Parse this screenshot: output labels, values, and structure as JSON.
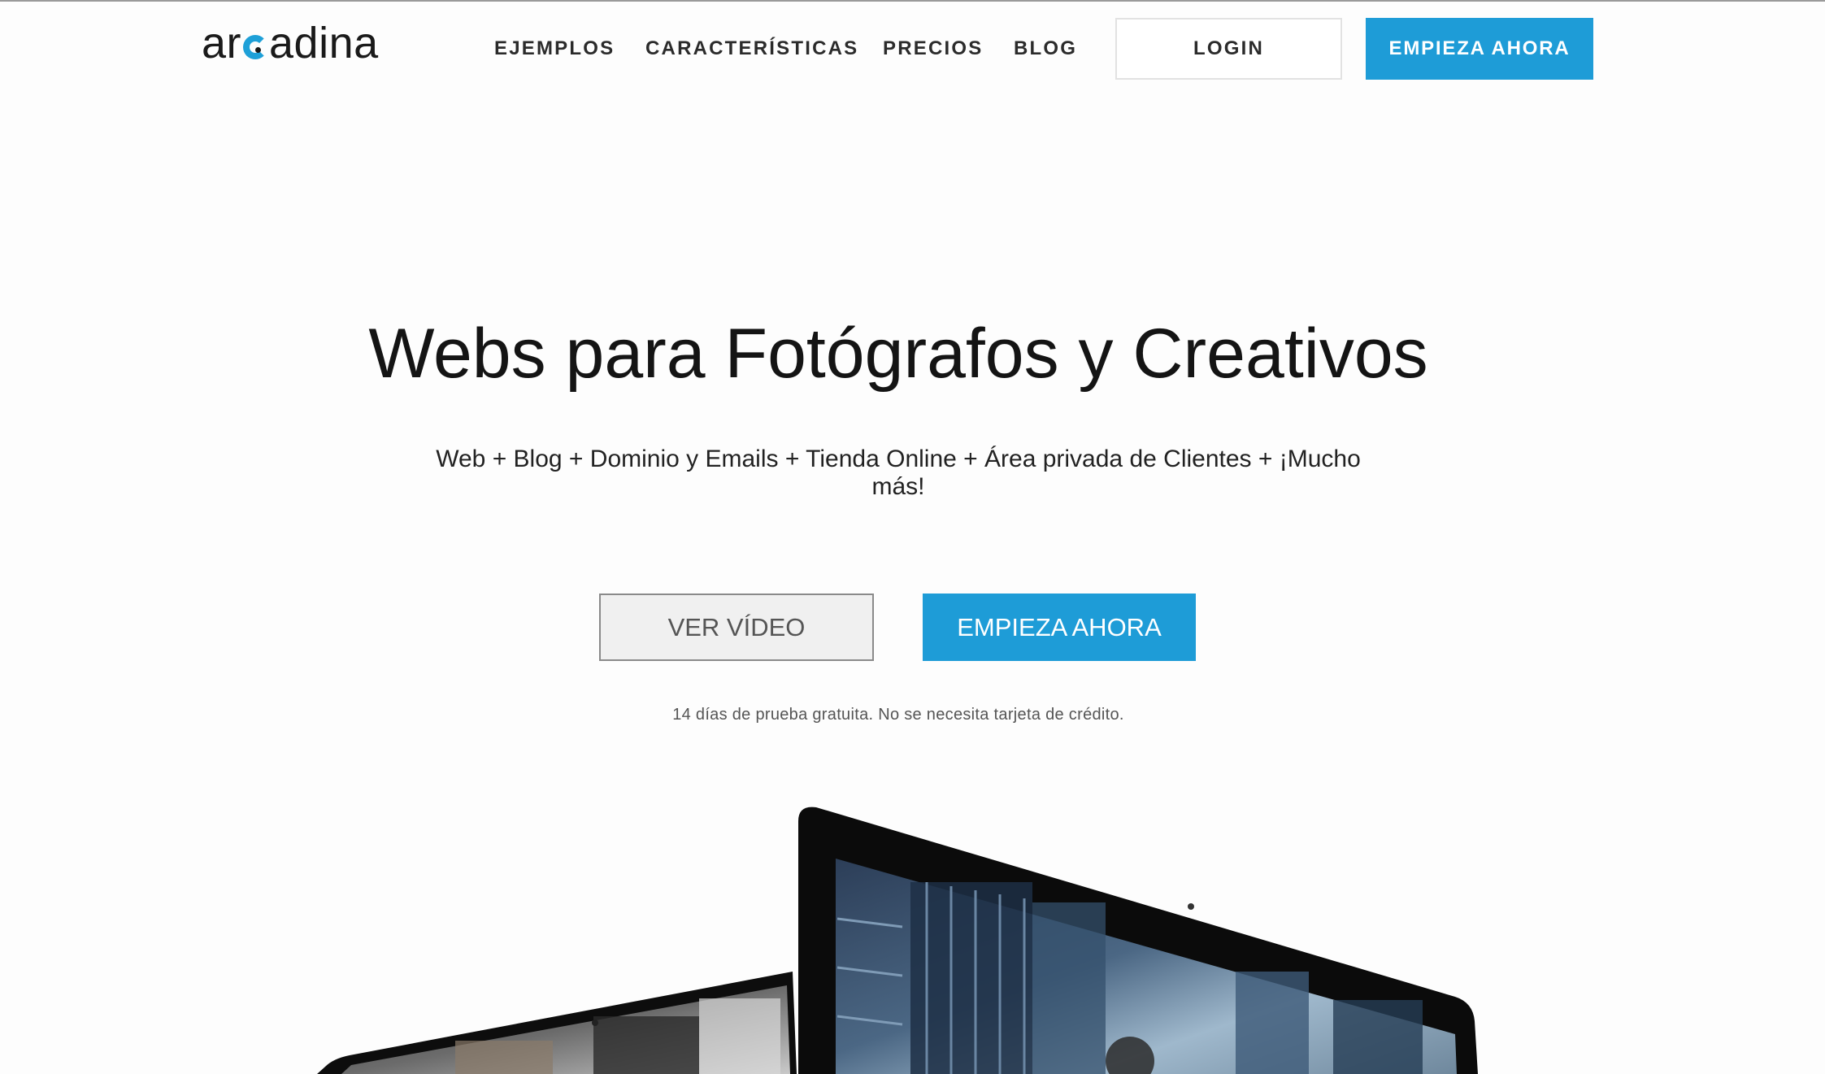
{
  "brand": {
    "logo_prefix": "ar",
    "logo_suffix": "adina",
    "accent_color": "#1e9cd7"
  },
  "nav": {
    "items": [
      {
        "label": "EJEMPLOS"
      },
      {
        "label": "CARACTERÍSTICAS"
      },
      {
        "label": "PRECIOS"
      },
      {
        "label": "BLOG"
      }
    ],
    "login_label": "LOGIN",
    "start_label": "EMPIEZA AHORA"
  },
  "hero": {
    "title": "Webs para Fotógrafos y Creativos",
    "subtitle": "Web + Blog + Dominio y Emails + Tienda Online + Área privada de Clientes + ¡Mucho más!",
    "video_button_label": "VER VÍDEO",
    "start_button_label": "EMPIEZA AHORA",
    "trial_note": "14 días de prueba gratuita. No se necesita tarjeta de crédito."
  },
  "devices": {
    "icons": [
      "laptop-icon",
      "monitor-icon"
    ]
  }
}
